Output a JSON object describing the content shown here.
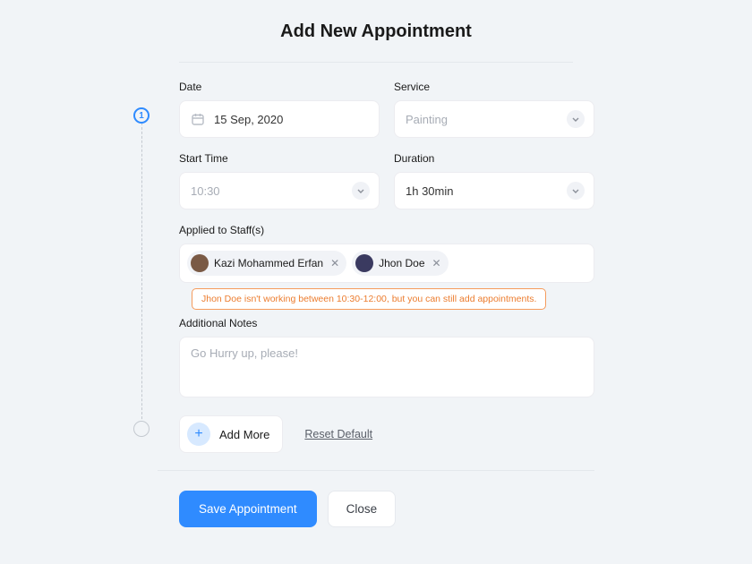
{
  "title": "Add New Appointment",
  "step": "1",
  "fields": {
    "date": {
      "label": "Date",
      "value": "15 Sep, 2020"
    },
    "service": {
      "label": "Service",
      "value": "Painting"
    },
    "start": {
      "label": "Start Time",
      "value": "10:30"
    },
    "duration": {
      "label": "Duration",
      "value": "1h 30min"
    },
    "staff": {
      "label": "Applied to Staff(s)",
      "chips": [
        "Kazi Mohammed Erfan",
        "Jhon Doe"
      ]
    },
    "warning": "Jhon Doe isn't working between 10:30-12:00, but you can still add appointments.",
    "notes": {
      "label": "Additional Notes",
      "placeholder": "Go Hurry up, please!"
    }
  },
  "actions": {
    "add_more": "Add More",
    "reset": "Reset Default",
    "save": "Save Appointment",
    "close": "Close"
  }
}
